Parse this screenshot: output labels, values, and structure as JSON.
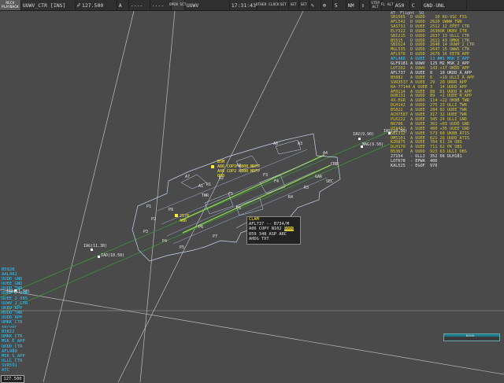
{
  "toolbar": {
    "recv": "RECV",
    "mode": "PLAYBACK",
    "position": "UUWV_CTR [INS]",
    "frequency": "127.500",
    "freq_mark": "A",
    "dashes": "----",
    "dashes2": "----",
    "open_sct": "OPEN SCT",
    "airport": "UUWV",
    "time": "17:31:43",
    "other_clock": "OTHER CLOCK",
    "set1": "SET",
    "set2": "SET",
    "set3": "SET",
    "range": "5",
    "unit": "NM",
    "step": "STEP",
    "alt": "ALT",
    "fl_alt": "FL ALT",
    "transition": "A50",
    "cdot": "C",
    "gnd": "GND-UNL"
  },
  "flight_list": {
    "headers": [
      "AT",
      "Flight",
      "SQ"
    ],
    "rows": [
      {
        "text": "SB1565  D UUDD    10 RU-VSC_FSS",
        "style": "yel"
      },
      {
        "text": "AFL542  D UUDD  2620 UWWW_TWR",
        "style": "yel"
      },
      {
        "text": "SAS731  D UUEE  2512 12 EPET_CTR",
        "style": "yel"
      },
      {
        "text": "ELY322  D UUDD  2630UK UKBV_CTR",
        "style": "yel"
      },
      {
        "text": "SBI215  D UUDD  2637 13 ULLL_CTR",
        "style": "yel"
      },
      {
        "text": "B5515   D UUDD  2611 43 UMKK_CTR",
        "style": "yel"
      },
      {
        "text": "SBI624  D UUDD  2640 14 UUWV_2_CTR",
        "style": "yel"
      },
      {
        "text": "MGL535  D UUDD  2647 15 UWWS_CTR",
        "style": "yel"
      },
      {
        "text": "AFL976  D UUDD  2670 16 EETN_APP",
        "style": "yel"
      },
      {
        "text": "AFL486  A UUEE  13 ##1 MSK_E_APP",
        "style": "sel"
      },
      {
        "text": "GLF9181 A UUWV  125 M2 MSK_2_APP",
        "style": "wht"
      },
      {
        "text": "LOT202  A UUWV  143 +17 UKDD_APP",
        "style": "yel"
      },
      {
        "text": "AFL737  A UUEE  0   10 UKDD_A_APP",
        "style": "wht"
      },
      {
        "text": "B5082   A UUEE  6   +19 ULLI_A_APP",
        "style": "yel"
      },
      {
        "text": "SVR3537 A UUEE  29  20 URRR_APP",
        "style": "yel"
      },
      {
        "text": "RA-77144 A UUEE 3   14 UUDD_APP",
        "style": "yel"
      },
      {
        "text": "AFR114  A UUEE  88  D1 UUDD_R_APP",
        "style": "yel"
      },
      {
        "text": "DOB131  A UUDD  89  +1 UUEE_R_APP",
        "style": "yel"
      },
      {
        "text": "4X-EGR  A UUDD  114 +22 UKBB_TWR",
        "style": "yel"
      },
      {
        "text": "DLH142  A UUDD  275 23 ULLI_TWR",
        "style": "yel"
      },
      {
        "text": "B5822   A UUEE  284 02 UUEE_TWR",
        "style": "yel"
      },
      {
        "text": "ACH7587 A UUEE  317 32 UUEE_TWR",
        "style": "yel"
      },
      {
        "text": "PLK222  A UUEE  345 24 ULLI_GND",
        "style": "yel"
      },
      {
        "text": "B6786   A UUEE  361 +03 UUDD_GND",
        "style": "yel"
      },
      {
        "text": "UTA452  A UUEE  400 +35 UUEE_GND",
        "style": "yel"
      },
      {
        "text": "SBI312  A UUEE  573 60 UKBB_ATIS",
        "style": "yel"
      },
      {
        "text": "OMS101  A UUEE  621 26 UUDD_ATIS",
        "style": "yel"
      },
      {
        "text": "KZR875  A UUEE  704 61 JA_OBS",
        "style": "yel"
      },
      {
        "text": "DLH170  A UUEE  711 62 PK_OBS",
        "style": "yel"
      },
      {
        "text": "B5367   A UUDD  923 63 ULLI_OBS",
        "style": "yel"
      },
      {
        "text": "27154   - ULLI  352 66 DLH181",
        "style": "wht"
      },
      {
        "text": "LOT678  - EPWA  406",
        "style": "wht"
      },
      {
        "text": "KAL525  - EGOF  970",
        "style": "wht"
      }
    ]
  },
  "stations": {
    "items": [
      "B5828",
      "AAL482",
      "UUDD_GND",
      "UUEE_GND",
      "UUDD_TWR",
      "UUEE_2_CTR",
      "UUEE_2_OBS",
      "UUWV_2_CTR",
      "UKBV_APP",
      "UUDD_TWR",
      "UUDD_APP",
      "UMKK_CTR",
      "server",
      "B5822",
      "UMKK_CTR",
      "MSK_E_APP",
      "UKDD_CTR",
      "AFL980",
      "MSK_S_APP",
      "ULLL_CTR",
      "SVR591",
      "ATC"
    ],
    "freq": "127.500"
  },
  "radar": {
    "fix_labels": [
      "IAG(11.30)",
      "IAD(10.50)",
      "IAV(9.90)",
      "MAG(9.50)",
      "IAD(11.50)",
      "IAS(10.50)"
    ],
    "fix_marker": "A",
    "ground_tags": [
      "A7",
      "A1",
      "A2",
      "A6",
      "A3",
      "A4",
      "F3",
      "F4",
      "F5",
      "F6",
      "P1",
      "P2",
      "P3",
      "P4",
      "P5",
      "P6",
      "P7",
      "P8",
      "R1",
      "R2",
      "R3",
      "R4",
      "GAR",
      "CRB",
      "SEC",
      "TWR"
    ],
    "target1": [
      "B5M",
      "A86 COP1 N800 NDFP",
      "A06 COP2 N800 NDFP",
      "000"
    ],
    "target2": [
      "2578",
      "A06"
    ]
  },
  "selected_tag": {
    "lines": [
      "CLAM",
      "AFL737 -- B734/M",
      "A06 COPY N102 ",
      "059 348 ASP ARC",
      "AHDG TXT"
    ],
    "highlight": "0000"
  },
  "mini_window": {
    "title": "Winds"
  }
}
